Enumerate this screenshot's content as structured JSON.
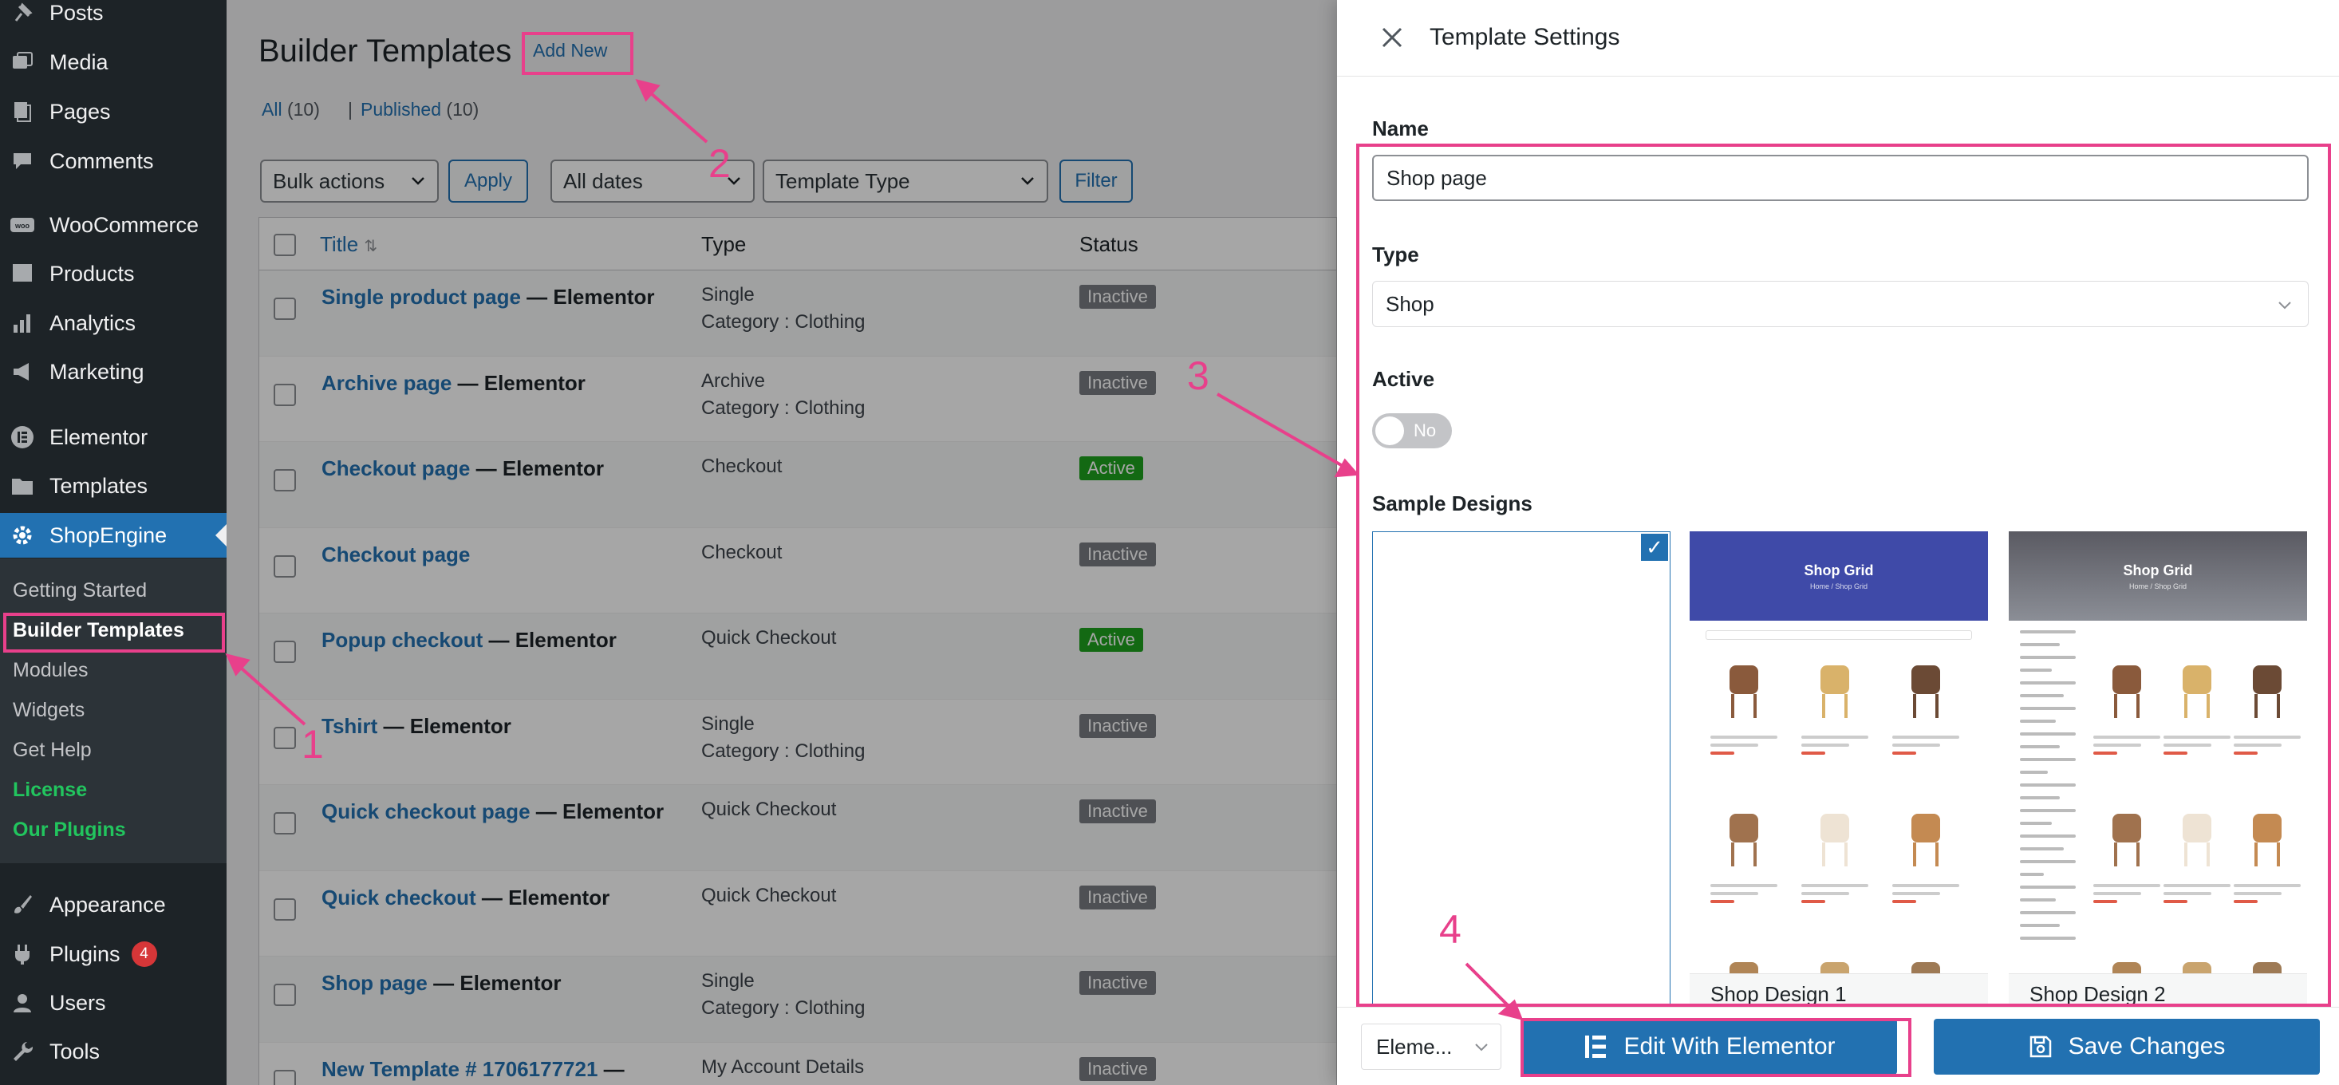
{
  "sidebar": {
    "items": [
      {
        "label": "Posts",
        "icon": "pin-icon"
      },
      {
        "label": "Media",
        "icon": "media-icon"
      },
      {
        "label": "Pages",
        "icon": "pages-icon"
      },
      {
        "label": "Comments",
        "icon": "comment-icon"
      },
      {
        "label": "WooCommerce",
        "icon": "woo-icon"
      },
      {
        "label": "Products",
        "icon": "products-icon"
      },
      {
        "label": "Analytics",
        "icon": "analytics-icon"
      },
      {
        "label": "Marketing",
        "icon": "megaphone-icon"
      },
      {
        "label": "Elementor",
        "icon": "elementor-icon"
      },
      {
        "label": "Templates",
        "icon": "folder-icon"
      },
      {
        "label": "ShopEngine",
        "icon": "gear-icon"
      },
      {
        "label": "Appearance",
        "icon": "brush-icon"
      },
      {
        "label": "Plugins",
        "icon": "plug-icon"
      },
      {
        "label": "Users",
        "icon": "user-icon"
      },
      {
        "label": "Tools",
        "icon": "wrench-icon"
      }
    ],
    "plugins_badge": "4",
    "submenu": [
      {
        "label": "Getting Started"
      },
      {
        "label": "Builder Templates"
      },
      {
        "label": "Modules"
      },
      {
        "label": "Widgets"
      },
      {
        "label": "Get Help"
      },
      {
        "label": "License"
      },
      {
        "label": "Our Plugins"
      }
    ]
  },
  "list_page": {
    "title": "Builder Templates",
    "add_new": "Add New",
    "filter_all": "All",
    "filter_all_count": "(10)",
    "filter_published": "Published",
    "filter_published_count": "(10)",
    "bulk_actions": "Bulk actions",
    "apply": "Apply",
    "all_dates": "All dates",
    "template_type": "Template Type",
    "filter": "Filter",
    "columns": {
      "title": "Title",
      "type": "Type",
      "status": "Status"
    },
    "rows": [
      {
        "title": "Single product page",
        "suffix": " — Elementor",
        "type": "Single",
        "category": "Category : Clothing",
        "status": "Inactive"
      },
      {
        "title": "Archive page",
        "suffix": " — Elementor",
        "type": "Archive",
        "category": "Category : Clothing",
        "status": "Inactive"
      },
      {
        "title": "Checkout page",
        "suffix": " — Elementor",
        "type": "Checkout",
        "category": "",
        "status": "Active"
      },
      {
        "title": "Checkout page",
        "suffix": "",
        "type": "Checkout",
        "category": "",
        "status": "Inactive"
      },
      {
        "title": "Popup checkout",
        "suffix": " — Elementor",
        "type": "Quick Checkout",
        "category": "",
        "status": "Active"
      },
      {
        "title": "Tshirt",
        "suffix": " — Elementor",
        "type": "Single",
        "category": "Category : Clothing",
        "status": "Inactive"
      },
      {
        "title": "Quick checkout page",
        "suffix": " — Elementor",
        "type": "Quick Checkout",
        "category": "",
        "status": "Inactive"
      },
      {
        "title": "Quick checkout",
        "suffix": " — Elementor",
        "type": "Quick Checkout",
        "category": "",
        "status": "Inactive"
      },
      {
        "title": "Shop page",
        "suffix": " — Elementor",
        "type": "Single",
        "category": "Category : Clothing",
        "status": "Inactive"
      },
      {
        "title": "New Template # 1706177721",
        "suffix": " —",
        "type": "My Account Details",
        "category": "",
        "status": "Inactive"
      }
    ]
  },
  "panel": {
    "title": "Template Settings",
    "name_label": "Name",
    "name_value": "Shop page",
    "type_label": "Type",
    "type_value": "Shop",
    "active_label": "Active",
    "active_toggle_text": "No",
    "sample_label": "Sample Designs",
    "designs": [
      {
        "name": "",
        "selected": true
      },
      {
        "name": "Shop Design 1",
        "hero_title": "Shop Grid",
        "hero_sub": "Home / Shop Grid"
      },
      {
        "name": "Shop Design 2",
        "hero_title": "Shop Grid",
        "hero_sub": "Home / Shop Grid"
      }
    ],
    "check_mark": "✓",
    "footer_select": "Eleme...",
    "edit_button": "Edit With Elementor",
    "save_button": "Save Changes"
  },
  "annotations": [
    "1",
    "2",
    "3",
    "4"
  ],
  "colors": {
    "accent": "#2271b1",
    "annotation": "#e8408b",
    "active_status": "#1ea21e",
    "inactive_status": "#787c82",
    "sidebar_bg": "#1d2327"
  }
}
